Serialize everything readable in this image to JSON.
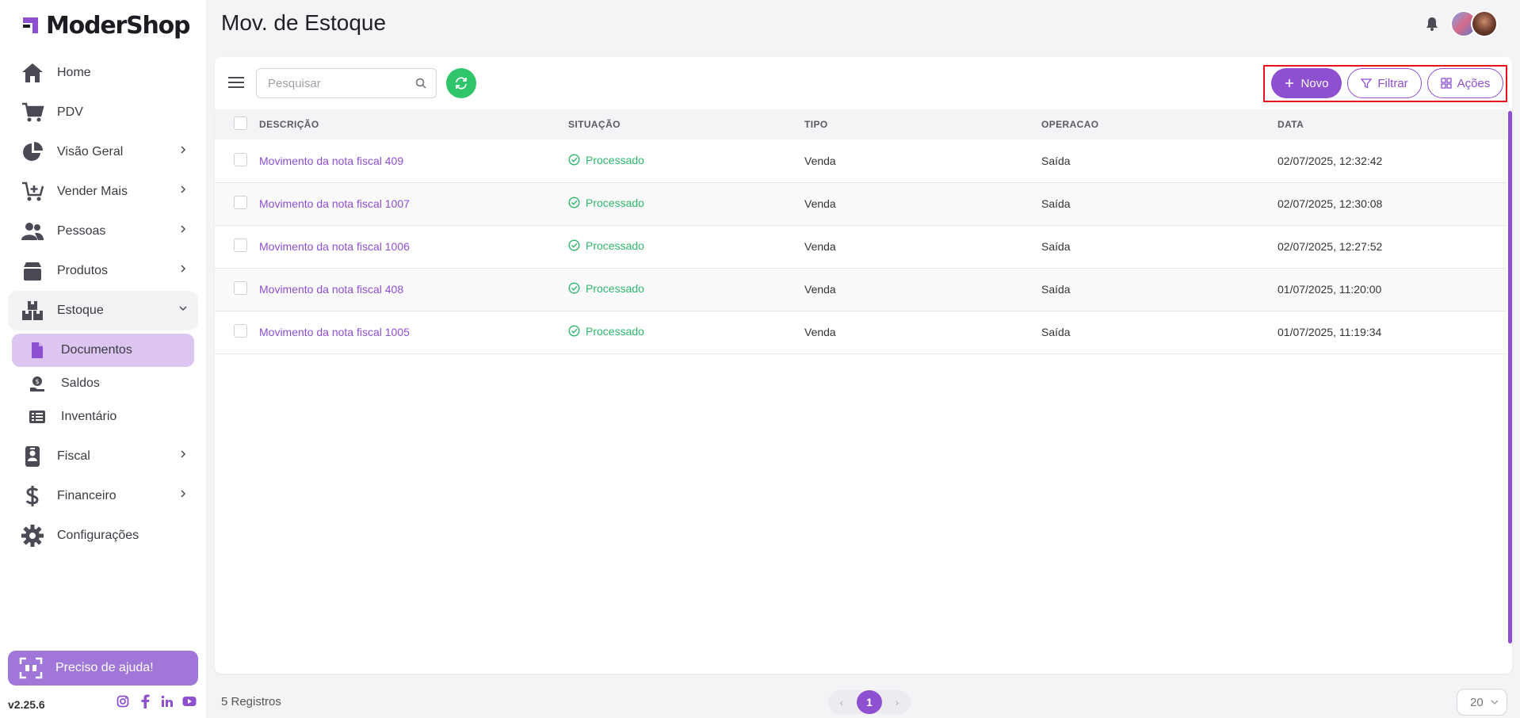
{
  "app": {
    "brand": "ModerShop",
    "version": "v2.25.6"
  },
  "sidebar": {
    "items": [
      {
        "label": "Home",
        "icon": "home-icon"
      },
      {
        "label": "PDV",
        "icon": "cart-icon"
      },
      {
        "label": "Visão Geral",
        "icon": "pie-chart-icon",
        "expandable": true
      },
      {
        "label": "Vender Mais",
        "icon": "cart-plus-icon",
        "expandable": true
      },
      {
        "label": "Pessoas",
        "icon": "users-icon",
        "expandable": true
      },
      {
        "label": "Produtos",
        "icon": "box-icon",
        "expandable": true
      },
      {
        "label": "Estoque",
        "icon": "boxes-icon",
        "expandable": true,
        "open": true
      },
      {
        "label": "Fiscal",
        "icon": "id-badge-icon",
        "expandable": true
      },
      {
        "label": "Financeiro",
        "icon": "dollar-icon",
        "expandable": true
      },
      {
        "label": "Configurações",
        "icon": "gear-icon"
      }
    ],
    "estoque_sub": [
      {
        "label": "Documentos",
        "icon": "file-icon",
        "active": true
      },
      {
        "label": "Saldos",
        "icon": "hand-coin-icon"
      },
      {
        "label": "Inventário",
        "icon": "list-icon"
      }
    ],
    "help_label": "Preciso de ajuda!",
    "socials": [
      "instagram-icon",
      "facebook-icon",
      "linkedin-icon",
      "youtube-icon"
    ]
  },
  "header": {
    "title": "Mov. de Estoque"
  },
  "toolbar": {
    "search_placeholder": "Pesquisar",
    "novo_label": "Novo",
    "filtrar_label": "Filtrar",
    "acoes_label": "Ações"
  },
  "table": {
    "columns": [
      "DESCRIÇÃO",
      "SITUAÇÃO",
      "TIPO",
      "OPERACAO",
      "DATA"
    ],
    "rows": [
      {
        "descricao": "Movimento da nota fiscal 409",
        "situacao": "Processado",
        "tipo": "Venda",
        "operacao": "Saída",
        "data": "02/07/2025, 12:32:42"
      },
      {
        "descricao": "Movimento da nota fiscal 1007",
        "situacao": "Processado",
        "tipo": "Venda",
        "operacao": "Saída",
        "data": "02/07/2025, 12:30:08"
      },
      {
        "descricao": "Movimento da nota fiscal 1006",
        "situacao": "Processado",
        "tipo": "Venda",
        "operacao": "Saída",
        "data": "02/07/2025, 12:27:52"
      },
      {
        "descricao": "Movimento da nota fiscal 408",
        "situacao": "Processado",
        "tipo": "Venda",
        "operacao": "Saída",
        "data": "01/07/2025, 11:20:00"
      },
      {
        "descricao": "Movimento da nota fiscal 1005",
        "situacao": "Processado",
        "tipo": "Venda",
        "operacao": "Saída",
        "data": "01/07/2025, 11:19:34"
      }
    ]
  },
  "footer": {
    "records": "5 Registros",
    "current_page": "1",
    "per_page": "20"
  },
  "colors": {
    "accent": "#8e4fd0",
    "success": "#2fc56b",
    "highlight": "#e5141b"
  }
}
